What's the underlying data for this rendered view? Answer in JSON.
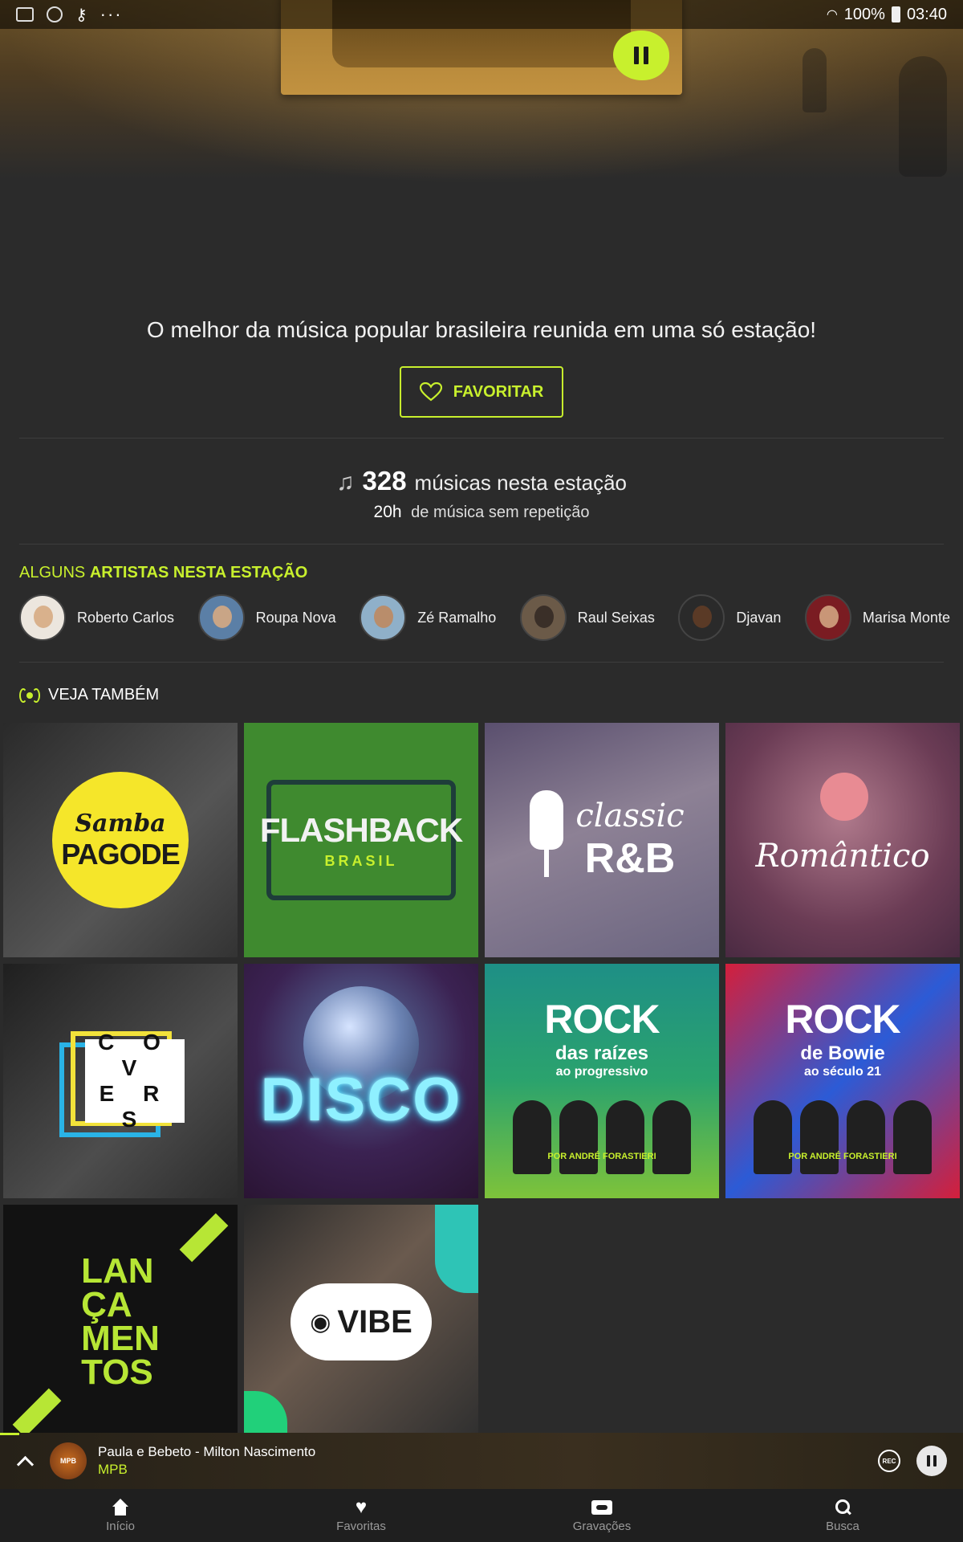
{
  "status_bar": {
    "battery": "100%",
    "time": "03:40"
  },
  "station": {
    "description": "O melhor da música popular brasileira reunida em uma só estação!",
    "favorite_label": "FAVORITAR",
    "song_count": "328",
    "song_count_label": "músicas nesta estação",
    "hours_value": "20h",
    "hours_label": "de música sem repetição"
  },
  "artists": {
    "title_prefix": "ALGUNS ",
    "title_bold": "ARTISTAS NESTA ESTAÇÃO",
    "items": [
      {
        "name": "Roberto Carlos"
      },
      {
        "name": "Roupa Nova"
      },
      {
        "name": "Zé Ramalho"
      },
      {
        "name": "Raul Seixas"
      },
      {
        "name": "Djavan"
      },
      {
        "name": "Marisa Monte"
      }
    ]
  },
  "see_also": {
    "title": "VEJA TAMBÉM",
    "tiles": [
      {
        "line1": "Samba",
        "line2": "PAGODE"
      },
      {
        "line1": "FLASHBACK",
        "line2": "BRASIL"
      },
      {
        "line1": "classic",
        "line2": "R&B"
      },
      {
        "line1": "Romântico"
      },
      {
        "line1": "C O V",
        "line2": "E R S"
      },
      {
        "line1": "DISCO"
      },
      {
        "line1": "ROCK",
        "line2": "das raízes",
        "line3": "ao progressivo",
        "credit": "POR ANDRÉ FORASTIERI"
      },
      {
        "line1": "ROCK",
        "line2": "de Bowie",
        "line3": "ao século 21",
        "credit": "POR ANDRÉ FORASTIERI"
      },
      {
        "line1": "LAN",
        "line2": "ÇA",
        "line3": "MEN",
        "line4": "TOS"
      },
      {
        "line1": "VIBE"
      }
    ]
  },
  "player": {
    "track": "Paula e Bebeto - Milton Nascimento",
    "station": "MPB",
    "cover_text": "MPB",
    "rec_label": "REC",
    "progress": 0.02
  },
  "nav": {
    "items": [
      {
        "label": "Início",
        "icon": "home-icon"
      },
      {
        "label": "Favoritas",
        "icon": "heart-icon"
      },
      {
        "label": "Gravações",
        "icon": "tape-icon"
      },
      {
        "label": "Busca",
        "icon": "search-icon"
      }
    ]
  },
  "colors": {
    "accent": "#c8f02d",
    "background": "#2b2b2b"
  }
}
